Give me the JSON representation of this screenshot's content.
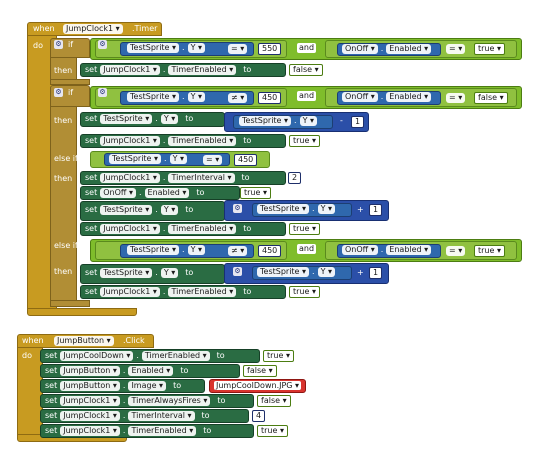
{
  "e1": {
    "when": "when",
    "do": "do",
    "component": "JumpClock1",
    "event": ".Timer",
    "if1": {
      "if": "if",
      "testsprite": "TestSprite",
      "y": "Y",
      "op": "=",
      "val": "550",
      "and": "and",
      "onoff": "OnOff",
      "enabled": "Enabled",
      "op2": "=",
      "bool": "true",
      "then": "then",
      "set": "set",
      "comp": "JumpClock1",
      "prop": "TimerEnabled",
      "to": "to",
      "tval": "false"
    },
    "if2": {
      "if": "if",
      "testsprite": "TestSprite",
      "y": "Y",
      "op": "≠",
      "val": "450",
      "and": "and",
      "onoff": "OnOff",
      "enabled": "Enabled",
      "op2": "=",
      "bool": "false",
      "then": "then",
      "s1_set": "set",
      "s1_comp": "TestSprite",
      "s1_prop": "Y",
      "s1_to": "to",
      "s1_inner_comp": "TestSprite",
      "s1_inner_prop": "Y",
      "s1_op": "-",
      "s1_num": "1",
      "s2_set": "set",
      "s2_comp": "JumpClock1",
      "s2_prop": "TimerEnabled",
      "s2_to": "to",
      "s2_val": "true",
      "elseif": "else if",
      "ei_comp": "TestSprite",
      "ei_prop": "Y",
      "ei_op": "=",
      "ei_val": "450",
      "then2": "then",
      "t1_set": "set",
      "t1_comp": "JumpClock1",
      "t1_prop": "TimerInterval",
      "t1_to": "to",
      "t1_val": "2",
      "t2_set": "set",
      "t2_comp": "OnOff",
      "t2_prop": "Enabled",
      "t2_to": "to",
      "t2_val": "true",
      "t3_set": "set",
      "t3_comp": "TestSprite",
      "t3_prop": "Y",
      "t3_to": "to",
      "t3_inner_comp": "TestSprite",
      "t3_inner_prop": "Y",
      "t3_op": "+",
      "t3_num": "1",
      "t4_set": "set",
      "t4_comp": "JumpClock1",
      "t4_prop": "TimerEnabled",
      "t4_to": "to",
      "t4_val": "true",
      "elseif2": "else if",
      "e2_comp": "TestSprite",
      "e2_prop": "Y",
      "e2_op": "≠",
      "e2_val": "450",
      "e2_and": "and",
      "e2_onoff": "OnOff",
      "e2_enabled": "Enabled",
      "e2_op2": "=",
      "e2_bool": "true",
      "then3": "then",
      "u1_set": "set",
      "u1_comp": "TestSprite",
      "u1_prop": "Y",
      "u1_to": "to",
      "u1_inner_comp": "TestSprite",
      "u1_inner_prop": "Y",
      "u1_op": "+",
      "u1_num": "1",
      "u2_set": "set",
      "u2_comp": "JumpClock1",
      "u2_prop": "TimerEnabled",
      "u2_to": "to",
      "u2_val": "true"
    }
  },
  "e2": {
    "when": "when",
    "do": "do",
    "component": "JumpButton",
    "event": ".Click",
    "rows": [
      {
        "set": "set",
        "comp": "JumpCoolDown",
        "prop": "TimerEnabled",
        "to": "to",
        "val": "true",
        "type": "bool"
      },
      {
        "set": "set",
        "comp": "JumpButton",
        "prop": "Enabled",
        "to": "to",
        "val": "false",
        "type": "bool"
      },
      {
        "set": "set",
        "comp": "JumpButton",
        "prop": "Image",
        "to": "to",
        "val": "JumpCoolDown.JPG",
        "type": "str"
      },
      {
        "set": "set",
        "comp": "JumpClock1",
        "prop": "TimerAlwaysFires",
        "to": "to",
        "val": "false",
        "type": "bool"
      },
      {
        "set": "set",
        "comp": "JumpClock1",
        "prop": "TimerInterval",
        "to": "to",
        "val": "4",
        "type": "num"
      },
      {
        "set": "set",
        "comp": "JumpClock1",
        "prop": "TimerEnabled",
        "to": "to",
        "val": "true",
        "type": "bool"
      }
    ]
  },
  "colors": {
    "event": "#c89b21",
    "control": "#b18e35",
    "setter": "#2a6c43",
    "logic": "#7fbd2b",
    "getter": "#2f68ad",
    "math": "#2b4fa8",
    "text": "#d9342e"
  }
}
